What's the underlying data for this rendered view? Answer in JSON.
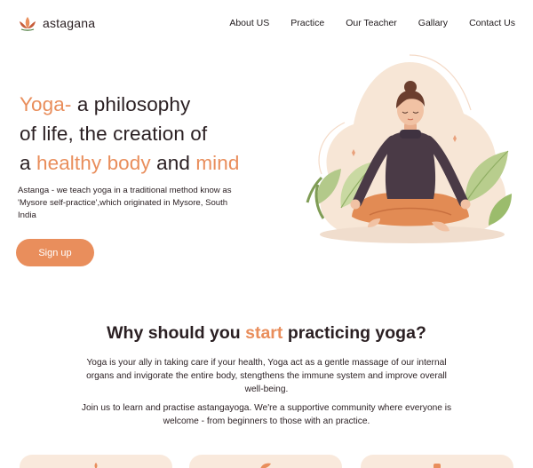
{
  "brand": {
    "name": "astagana",
    "icon": "lotus-icon",
    "accent_color": "#e98e5c"
  },
  "nav": {
    "items": [
      {
        "label": "About US"
      },
      {
        "label": "Practice"
      },
      {
        "label": "Our Teacher"
      },
      {
        "label": "Gallary"
      },
      {
        "label": "Contact Us"
      }
    ]
  },
  "hero": {
    "line1_accent": "Yoga-",
    "line1_rest": " a philosophy",
    "line2": "of life, the creation of",
    "line3_a": "a ",
    "line3_accent1": "healthy body",
    "line3_b": " and ",
    "line3_accent2": "mind",
    "description": "Astanga - we teach yoga in a traditional method know as 'Mysore self-practice',which originated in Mysore, South India",
    "signup_label": "Sign up",
    "illustration": "meditating-woman-illustration"
  },
  "why": {
    "title_a": "Why should you ",
    "title_accent": "start",
    "title_b": " practicing yoga?",
    "paragraph1": "Yoga is your ally in taking care if your health, Yoga act as a gentle massage of our internal organs and invigorate the entire body, stengthens the immune system and improve overall well-being.",
    "paragraph2": "Join us to learn and practise astangayoga. We're a supportive community where everyone is welcome - from beginners to those with an practice."
  },
  "cards": [
    {
      "icon": "lotus-icon"
    },
    {
      "icon": "leaf-icon"
    },
    {
      "icon": "mat-icon"
    }
  ]
}
